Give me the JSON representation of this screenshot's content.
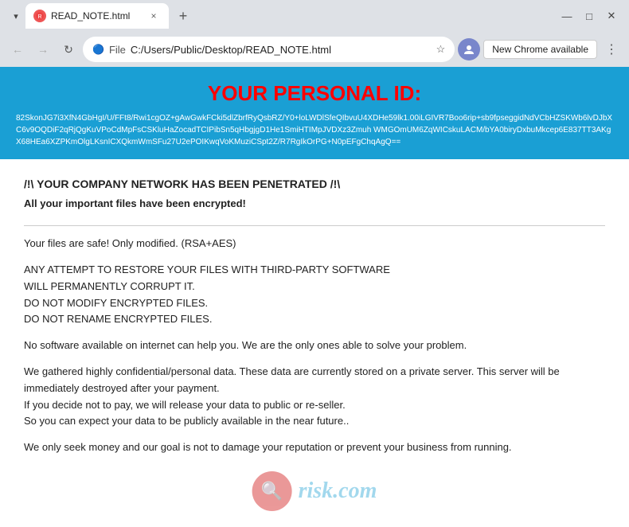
{
  "browser": {
    "tab": {
      "favicon_label": "R",
      "title": "READ_NOTE.html",
      "close_label": "×"
    },
    "new_tab_label": "+",
    "window_title": "READ_NOTE.html",
    "controls": {
      "minimize": "—",
      "maximize": "□",
      "close": "✕"
    },
    "nav": {
      "back": "←",
      "forward": "→",
      "refresh": "↻"
    },
    "omnibar": {
      "scheme": "File",
      "path": "C:/Users/Public/Desktop/READ_NOTE.html",
      "star": "☆"
    },
    "new_chrome_btn": "New Chrome available",
    "more_btn": "⋮"
  },
  "page": {
    "header": {
      "title": "YOUR PERSONAL ID:",
      "id_value": "82SkonJG7i3XfN4GbHgI/U/FFt8/Rwi1cgOZ+gAwGwkFCki5dlZbrfRyQsbRZ/Y0+loLWDlSfeQIbvuU4XDHe59lk1.00iLGIVR7Boo6rip+sb9fpseggidNdVCbHZSKWb6lvDJbXC6v9OQDiF2qRjQgKuVPoCdMpFsCSKluHaZocadTCIPibSn5qHbgjgD1He1SmiHTIMpJVDXz3Zmuh WMGOmUM6ZqWICskuLACM/bYA0biryDxbuMkcep6E837TT3AKgX68HEa6XZPKmOlgLKsnICXQkmWmSFu27U2ePOIKwqVoKMuziCSpt2Z/R7RgIkOrPG+N0pEFgChqAgQ=="
    },
    "content": {
      "headline": "/!\\ YOUR COMPANY NETWORK HAS BEEN PENETRATED /!\\",
      "subheadline": "All your important files have been encrypted!",
      "para1": "Your files are safe! Only modified. (RSA+AES)",
      "para2_lines": [
        "ANY ATTEMPT TO RESTORE YOUR FILES WITH THIRD-PARTY SOFTWARE",
        "WILL PERMANENTLY CORRUPT IT.",
        "DO NOT MODIFY ENCRYPTED FILES.",
        "DO NOT RENAME ENCRYPTED FILES."
      ],
      "para3": "No software available on internet can help you. We are the only ones able to solve your problem.",
      "para4": "We gathered highly confidential/personal data. These data are currently stored on a private server. This server will be immediately destroyed after your payment. If you decide not to pay, we will release your data to public or re-seller. So you can expect your data to be publicly available in the near future..",
      "para5": "We only seek money and our goal is not to damage your reputation or prevent your business from running."
    },
    "watermark": {
      "icon_label": "🔍",
      "text": "risk.com"
    }
  }
}
